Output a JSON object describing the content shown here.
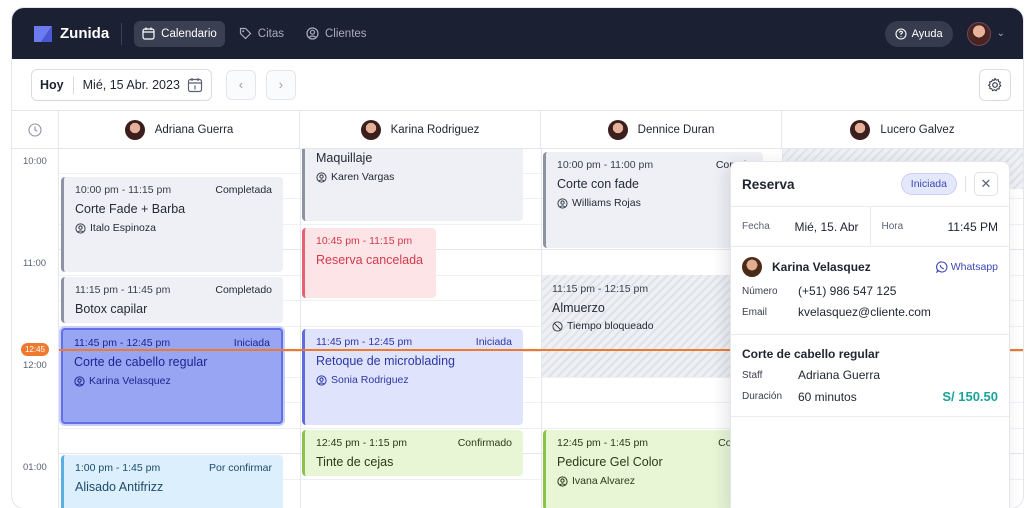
{
  "app": {
    "name": "Zunida"
  },
  "nav": {
    "tabs": [
      {
        "label": "Calendario",
        "icon": "calendar-icon",
        "active": true
      },
      {
        "label": "Citas",
        "icon": "tag-icon",
        "active": false
      },
      {
        "label": "Clientes",
        "icon": "user-circle-icon",
        "active": false
      }
    ],
    "help_label": "Ayuda"
  },
  "toolbar": {
    "today_label": "Hoy",
    "date_label": "Mié, 15 Abr. 2023"
  },
  "staff": [
    {
      "name": "Adriana Guerra"
    },
    {
      "name": "Karina Rodriguez"
    },
    {
      "name": "Dennice Duran"
    },
    {
      "name": "Lucero Galvez"
    }
  ],
  "time_labels": [
    "10:00",
    "11:00",
    "12:00",
    "01:00"
  ],
  "now_badge": "12:45",
  "events": [
    {
      "time": "10:00 pm - 11:15 pm",
      "status": "Completada",
      "title": "Corte Fade + Barba",
      "client": "Italo Espinoza"
    },
    {
      "time": "11:15 pm - 11:45 pm",
      "status": "Completado",
      "title": "Botox capilar",
      "client": ""
    },
    {
      "time": "11:45 pm - 12:45 pm",
      "status": "Iniciada",
      "title": "Corte de cabello regular",
      "client": "Karina Velasquez"
    },
    {
      "time": "1:00 pm - 1:45 pm",
      "status": "Por confirmar",
      "title": "Alisado Antifrizz",
      "client": ""
    },
    {
      "time": "",
      "status": "",
      "title": "Maquillaje",
      "client": "Karen Vargas"
    },
    {
      "time": "10:45 pm - 11:15 pm",
      "status": "",
      "title": "Reserva cancelada",
      "client": ""
    },
    {
      "time": "11:45 pm - 12:45 pm",
      "status": "Iniciada",
      "title": "Retoque de microblading",
      "client": "Sonia Rodriguez"
    },
    {
      "time": "12:45 pm - 1:15 pm",
      "status": "Confirmado",
      "title": "Tinte de cejas",
      "client": ""
    },
    {
      "time": "10:00 pm - 11:00 pm",
      "status": "Comple",
      "title": "Corte con fade",
      "client": "Williams Rojas"
    },
    {
      "time": "11:15 pm - 12:15 pm",
      "status": "",
      "title": "Almuerzo",
      "client": "Tiempo bloqueado"
    },
    {
      "time": "12:45 pm - 1:45 pm",
      "status": "Confirn",
      "title": "Pedicure Gel Color",
      "client": "Ivana Alvarez"
    }
  ],
  "panel": {
    "title": "Reserva",
    "badge": "Iniciada",
    "fecha_label": "Fecha",
    "fecha_value": "Mié, 15. Abr",
    "hora_label": "Hora",
    "hora_value": "11:45 PM",
    "client_name": "Karina Velasquez",
    "whatsapp_label": "Whatsapp",
    "numero_label": "Número",
    "numero_value": "(+51) 986 547 125",
    "email_label": "Email",
    "email_value": "kvelasquez@cliente.com",
    "service_title": "Corte de cabello regular",
    "staff_label": "Staff",
    "staff_value": "Adriana Guerra",
    "duracion_label": "Duración",
    "duracion_value": "60 minutos",
    "price": "S/ 150.50"
  },
  "colors": {
    "nav_bg": "#1c2033",
    "accent": "#5f6cde",
    "now_line": "#ef7a2f",
    "price": "#1aa39a"
  }
}
